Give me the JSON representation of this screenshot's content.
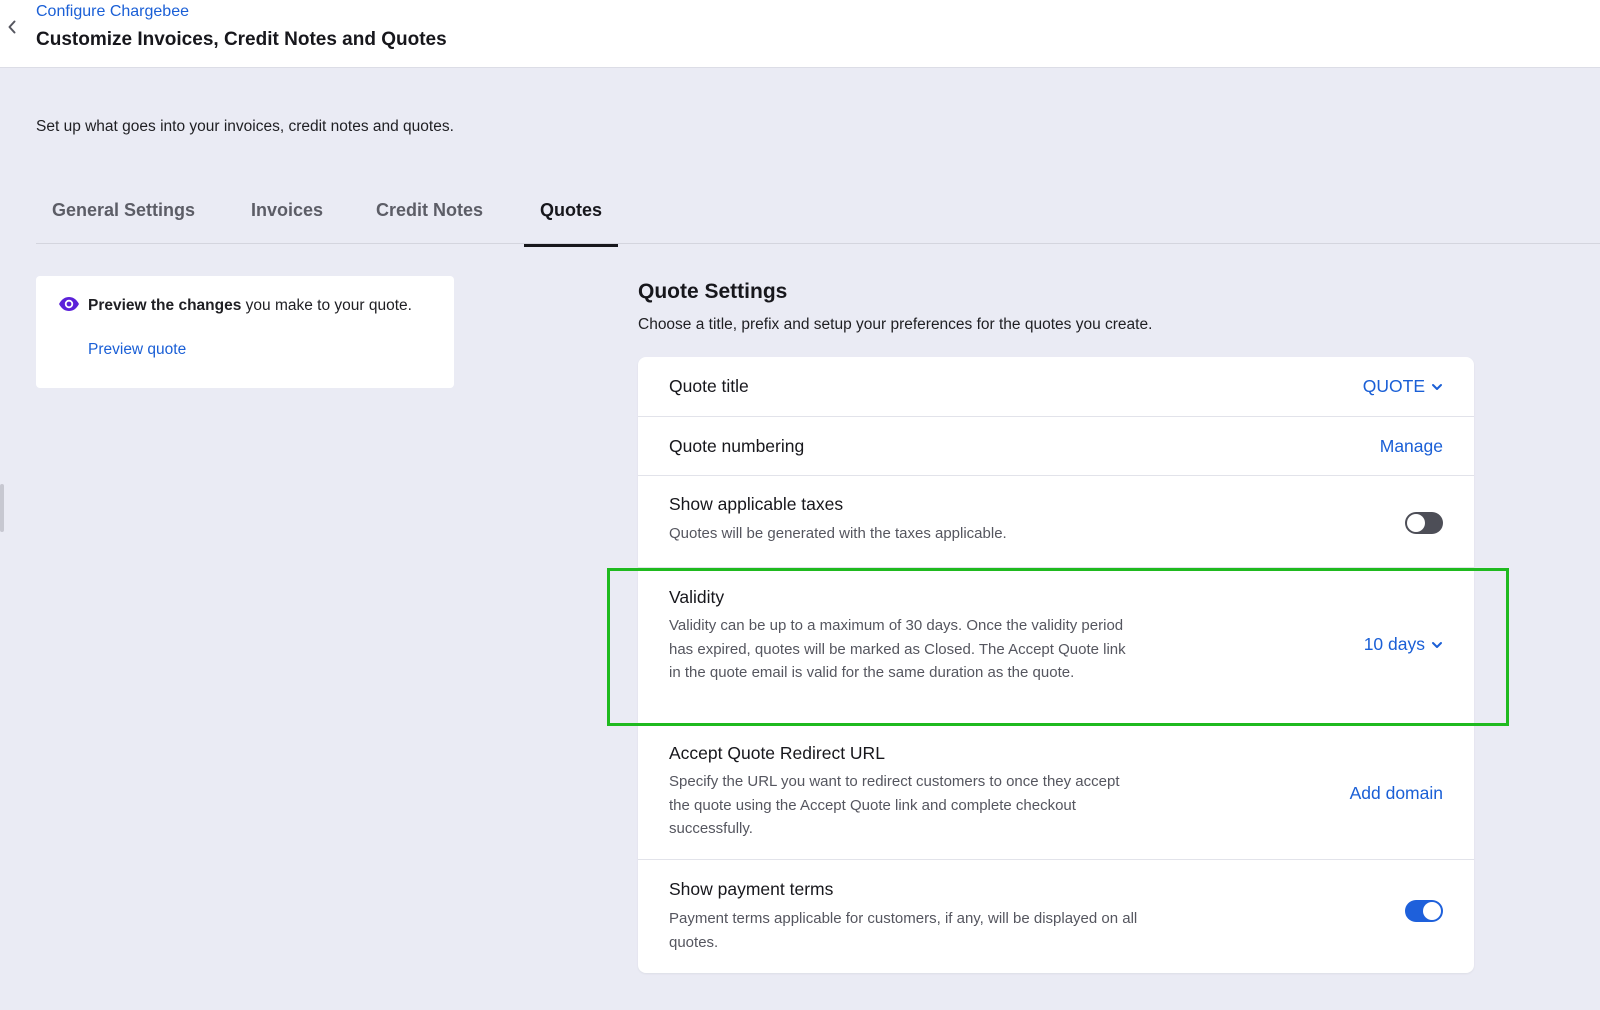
{
  "header": {
    "breadcrumb": "Configure Chargebee",
    "title": "Customize Invoices, Credit Notes and Quotes"
  },
  "description": "Set up what goes into your invoices, credit notes and quotes.",
  "tabs": [
    {
      "label": "General Settings",
      "active": false
    },
    {
      "label": "Invoices",
      "active": false
    },
    {
      "label": "Credit Notes",
      "active": false
    },
    {
      "label": "Quotes",
      "active": true
    }
  ],
  "preview": {
    "bold_text": "Preview the changes",
    "text": " you make to your quote.",
    "link": "Preview quote"
  },
  "quote_settings": {
    "title": "Quote Settings",
    "subtitle": "Choose a title, prefix and setup your preferences for the quotes you create.",
    "rows": [
      {
        "label": "Quote title",
        "action": "QUOTE"
      },
      {
        "label": "Quote numbering",
        "action": "Manage"
      },
      {
        "label": "Show applicable taxes",
        "description": "Quotes will be generated with the taxes applicable.",
        "toggle": false
      },
      {
        "label": "Validity",
        "description": "Validity can be up to a maximum of 30 days. Once the validity period has expired, quotes will be marked as Closed. The Accept Quote link in the quote email is valid for the same duration as the quote.",
        "action": "10 days"
      },
      {
        "label": "Accept Quote Redirect URL",
        "description": "Specify the URL you want to redirect customers to once they accept the quote using the Accept Quote link and complete checkout successfully.",
        "action": "Add domain"
      },
      {
        "label": "Show payment terms",
        "description": "Payment terms applicable for customers, if any, will be displayed on all quotes.",
        "toggle": true
      }
    ]
  },
  "colors": {
    "accent": "#1a5fd6",
    "highlight": "#1fba1f",
    "toggle_on": "#1e60db",
    "toggle_off": "#4d4e57",
    "eye_icon": "#5b21d9"
  }
}
